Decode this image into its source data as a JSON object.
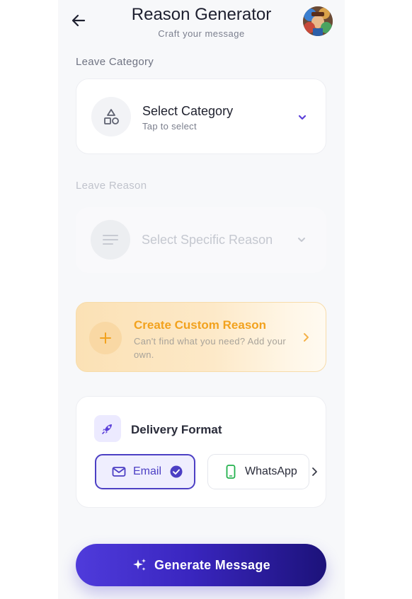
{
  "header": {
    "title": "Reason Generator",
    "subtitle": "Craft your message",
    "back_icon": "arrow-left-icon",
    "avatar_icon": "user-avatar"
  },
  "category": {
    "section_label": "Leave Category",
    "title": "Select Category",
    "subtitle": "Tap to select",
    "icon": "shapes-icon",
    "chevron": "chevron-down-icon",
    "accent": "#5b3fd9"
  },
  "reason": {
    "section_label": "Leave Reason",
    "placeholder": "Select Specific Reason",
    "icon": "lines-icon",
    "chevron": "chevron-down-icon",
    "disabled": true
  },
  "custom_reason": {
    "title": "Create Custom Reason",
    "description": "Can't find what you need? Add your own.",
    "icon": "plus-icon",
    "chevron": "chevron-right-icon",
    "accent": "#f2a21e"
  },
  "delivery": {
    "title": "Delivery Format",
    "icon": "rocket-icon",
    "options": [
      {
        "label": "Email",
        "icon": "mail-icon",
        "selected": true
      },
      {
        "label": "WhatsApp",
        "icon": "phone-icon",
        "selected": false
      }
    ],
    "more_icon": "chevron-right-icon"
  },
  "generate": {
    "label": "Generate Message",
    "icon": "sparkle-icon"
  }
}
